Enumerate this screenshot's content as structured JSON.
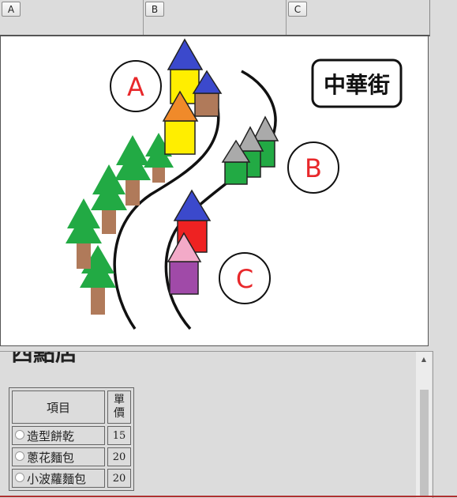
{
  "tabs": [
    {
      "label": "A"
    },
    {
      "label": "B"
    },
    {
      "label": "C"
    }
  ],
  "scene": {
    "street_sign": "中華街",
    "areas": [
      {
        "label": "A",
        "color": "#e8282b"
      },
      {
        "label": "B",
        "color": "#e8282b"
      },
      {
        "label": "C",
        "color": "#e8282b"
      }
    ]
  },
  "shop": {
    "title": "西點店",
    "headers": {
      "item": "項目",
      "price": "單價"
    },
    "items": [
      {
        "name": "造型餅乾",
        "price": "15"
      },
      {
        "name": "蔥花麵包",
        "price": "20"
      },
      {
        "name": "小波蘿麵包",
        "price": "20"
      }
    ]
  }
}
